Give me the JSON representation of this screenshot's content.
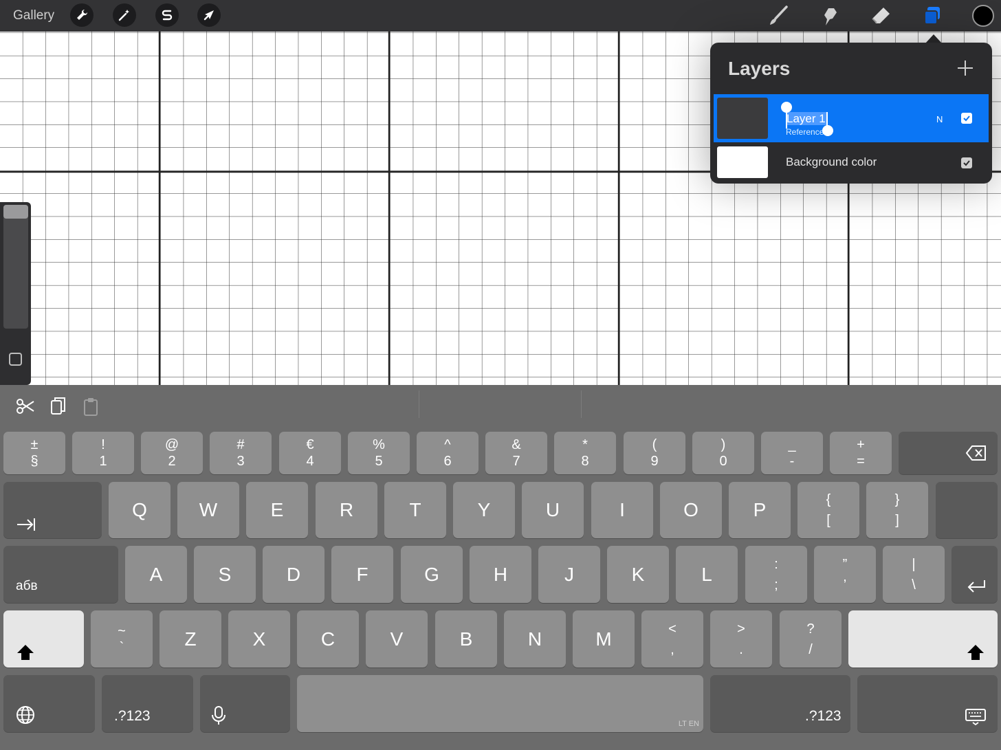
{
  "topbar": {
    "gallery": "Gallery",
    "left_tools": [
      "wrench-icon",
      "magic-wand-icon",
      "selection-s-icon",
      "move-arrow-icon"
    ],
    "right_tools": [
      "brush-icon",
      "smudge-icon",
      "eraser-icon",
      "layers-icon",
      "color-swatch-icon"
    ],
    "accent": "#0b76f5"
  },
  "layers": {
    "title": "Layers",
    "add_icon": "plus-icon",
    "rows": [
      {
        "name": "Layer 1",
        "sub": "Reference",
        "blend": "N",
        "checked": true,
        "selected": true
      },
      {
        "name": "Background color",
        "checked": true,
        "selected": false
      }
    ]
  },
  "keyboard": {
    "shortcut_icons": [
      "scissors-icon",
      "copy-icon",
      "paste-icon"
    ],
    "row1": [
      [
        "±",
        "§"
      ],
      [
        "!",
        "1"
      ],
      [
        "@",
        "2"
      ],
      [
        "#",
        "3"
      ],
      [
        "€",
        "4"
      ],
      [
        "%",
        "5"
      ],
      [
        "^",
        "6"
      ],
      [
        "&",
        "7"
      ],
      [
        "*",
        "8"
      ],
      [
        "(",
        "9"
      ],
      [
        ")",
        "0"
      ],
      [
        "_",
        "-"
      ],
      [
        "+",
        "="
      ]
    ],
    "row2": [
      "Q",
      "W",
      "E",
      "R",
      "T",
      "Y",
      "U",
      "I",
      "O",
      "P"
    ],
    "row2_extra": [
      [
        "{",
        "["
      ],
      [
        "}",
        "]"
      ]
    ],
    "row3": [
      "A",
      "S",
      "D",
      "F",
      "G",
      "H",
      "J",
      "K",
      "L"
    ],
    "row3_extra": [
      [
        ":",
        ";"
      ],
      [
        "”",
        "’"
      ],
      [
        "|",
        "\\"
      ]
    ],
    "row4": [
      "Z",
      "X",
      "C",
      "V",
      "B",
      "N",
      "M"
    ],
    "row4_first": [
      "~",
      "`"
    ],
    "row4_extra": [
      [
        "<",
        ","
      ],
      [
        ">",
        "."
      ],
      [
        "?",
        "/"
      ]
    ],
    "lang_label": "абв",
    "numbers_label": ".?123",
    "numbers_label_right": ".?123",
    "space_hint": "LT EN"
  }
}
